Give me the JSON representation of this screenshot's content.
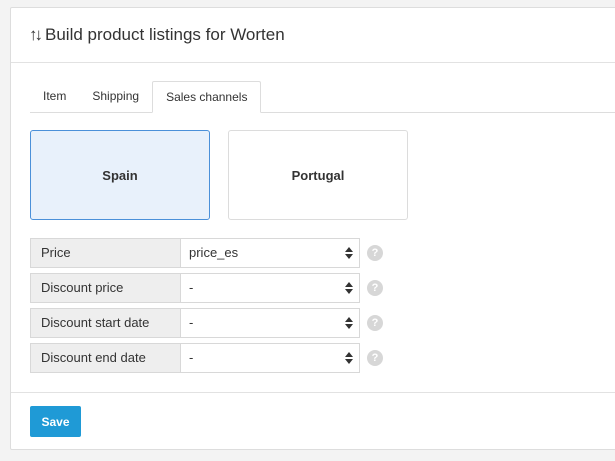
{
  "header": {
    "icon": "sort-arrows-icon",
    "title": "Build product listings for Worten"
  },
  "tabs": [
    {
      "label": "Item",
      "active": false
    },
    {
      "label": "Shipping",
      "active": false
    },
    {
      "label": "Sales channels",
      "active": true
    }
  ],
  "channels": [
    {
      "label": "Spain",
      "selected": true
    },
    {
      "label": "Portugal",
      "selected": false
    }
  ],
  "fields": [
    {
      "label": "Price",
      "value": "price_es"
    },
    {
      "label": "Discount price",
      "value": "-"
    },
    {
      "label": "Discount start date",
      "value": "-"
    },
    {
      "label": "Discount end date",
      "value": "-"
    }
  ],
  "help_glyph": "?",
  "save_label": "Save",
  "colors": {
    "accent": "#1f9ad6",
    "selected_bg": "#e8f1fb",
    "selected_border": "#4a90d9"
  }
}
